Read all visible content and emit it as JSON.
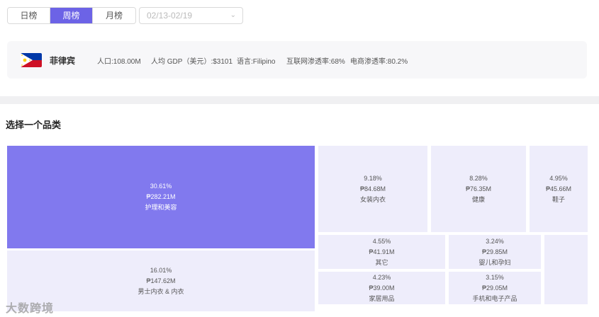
{
  "tabs": [
    {
      "label": "日榜",
      "active": false
    },
    {
      "label": "周榜",
      "active": true
    },
    {
      "label": "月榜",
      "active": false
    }
  ],
  "date_select": {
    "placeholder": "02/13-02/19"
  },
  "country": {
    "name": "菲律宾",
    "population": "人口:108.00M",
    "gdp": "人均 GDP（美元）:$3101",
    "language": "语言:Filipino",
    "internet": "互联网渗透率:68%",
    "ecommerce": "电商渗透率:80.2%"
  },
  "section_title": "选择一个品类",
  "categories": [
    {
      "pct": "30.61%",
      "amount": "₱282.21M",
      "name": "护理和美容"
    },
    {
      "pct": "16.01%",
      "amount": "₱147.62M",
      "name": "男士内衣 & 内衣"
    },
    {
      "pct": "9.18%",
      "amount": "₱84.68M",
      "name": "女装内衣"
    },
    {
      "pct": "8.28%",
      "amount": "₱76.35M",
      "name": "健康"
    },
    {
      "pct": "4.95%",
      "amount": "₱45.66M",
      "name": "鞋子"
    },
    {
      "pct": "4.55%",
      "amount": "₱41.91M",
      "name": "其它"
    },
    {
      "pct": "3.24%",
      "amount": "₱29.85M",
      "name": "婴儿和孕妇"
    },
    {
      "pct": "4.23%",
      "amount": "₱39.00M",
      "name": "家居用品"
    },
    {
      "pct": "3.15%",
      "amount": "₱29.05M",
      "name": "手机和电子产品"
    }
  ],
  "watermark": "大数跨境",
  "colors": {
    "accent": "#6c63e6",
    "tile_active": "#8179ee",
    "tile": "#eeedfb"
  }
}
